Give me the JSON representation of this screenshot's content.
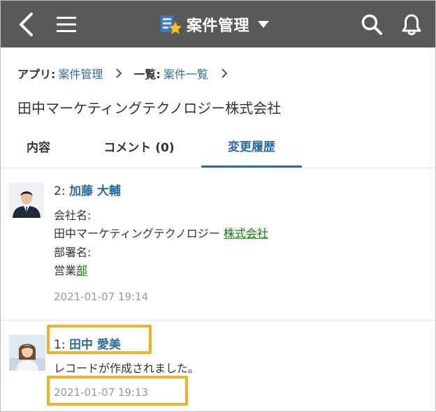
{
  "header": {
    "title": "案件管理",
    "icons": [
      "back-icon",
      "menu-icon",
      "app-icon",
      "chevron-down-icon",
      "search-icon",
      "bell-icon"
    ],
    "bar_color": "#595959"
  },
  "breadcrumb": {
    "app_label": "アプリ:",
    "app_link": "案件管理",
    "list_label": "一覧:",
    "list_link": "案件一覧"
  },
  "record": {
    "title": "田中マーケティングテクノロジー株式会社"
  },
  "tabs": [
    {
      "label": "内容",
      "active": false
    },
    {
      "label": "コメント (0)",
      "active": false
    },
    {
      "label": "変更履歴",
      "active": true
    }
  ],
  "history": [
    {
      "number": "2:",
      "author": "加藤 大輔",
      "field1_label": "会社名:",
      "field1_value_prefix": "田中マーケティングテクノロジー ",
      "field1_value_added": "株式会社",
      "field2_label": "部署名:",
      "field2_value_prefix": "営業",
      "field2_value_added": "部",
      "timestamp": "2021-01-07 19:14"
    },
    {
      "number": "1:",
      "author": "田中 愛美",
      "message": "レコードが作成されました。",
      "timestamp": "2021-01-07 19:13"
    }
  ],
  "colors": {
    "link": "#2d6aa0",
    "highlight": "#f2b02e",
    "added_text": "#2f6e2f",
    "added_bg": "#e8f5e4"
  }
}
